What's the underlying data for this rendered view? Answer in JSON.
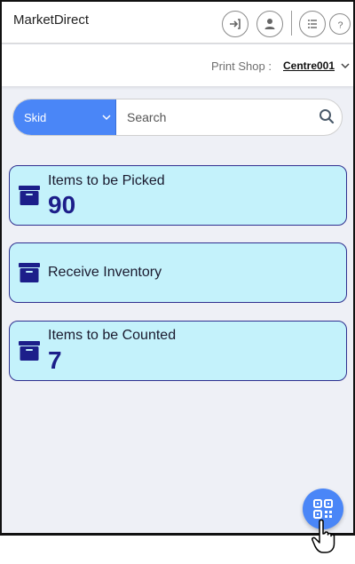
{
  "app": {
    "title": "MarketDirect"
  },
  "header_buttons": [
    {
      "name": "sign-in",
      "icon": "sign-in-icon"
    },
    {
      "name": "user",
      "icon": "user-icon"
    },
    {
      "name": "list",
      "icon": "list-icon"
    },
    {
      "name": "help",
      "icon": "help-icon"
    }
  ],
  "shop": {
    "label": "Print Shop :",
    "value": "Centre001"
  },
  "search": {
    "type_selected": "Skid",
    "placeholder": "Search"
  },
  "cards": [
    {
      "title": "Items to be Picked",
      "count": "90"
    },
    {
      "title": "Receive Inventory"
    },
    {
      "title": "Items to be Counted",
      "count": "7"
    }
  ],
  "colors": {
    "accent": "#4a86f7",
    "card_bg": "#c4f2fb",
    "card_border": "#2f2f8f",
    "count_text": "#1c1e8a",
    "icon": "#1c1e8a"
  }
}
